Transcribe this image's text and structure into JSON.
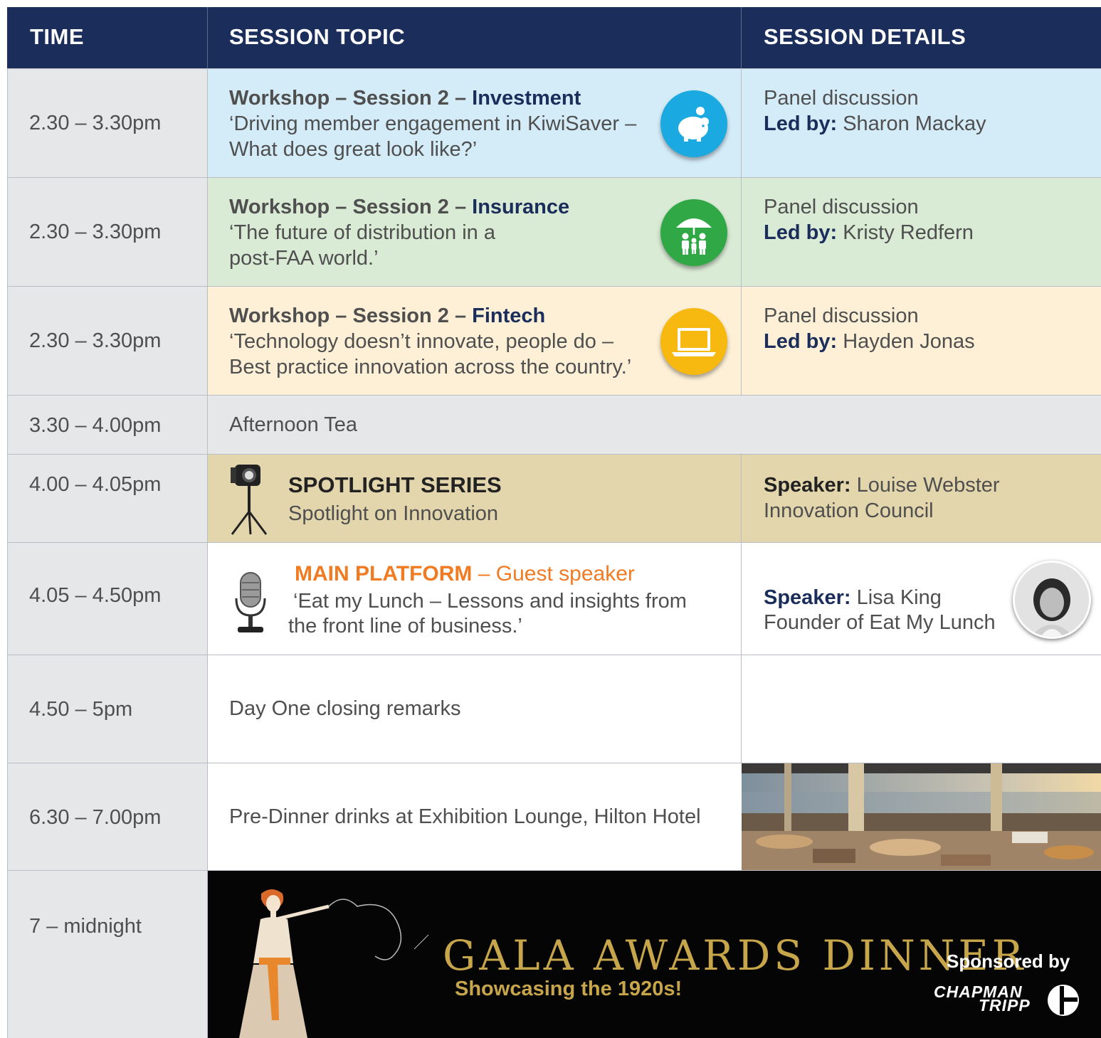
{
  "header": {
    "time": "TIME",
    "topic": "SESSION TOPIC",
    "details": "SESSION DETAILS"
  },
  "rows": [
    {
      "time": "2.30 – 3.30pm",
      "prefix": "Workshop – Session 2 – ",
      "stream": "Investment",
      "desc1": "‘Driving member engagement in KiwiSaver –",
      "desc2": "What does great look like?’",
      "icon": "piggy-bank-icon",
      "detail_line1": "Panel discussion",
      "led_label": "Led by:",
      "led_name": "Sharon Mackay",
      "bg": "#d4ecf8",
      "icon_color": "#1aa9e1"
    },
    {
      "time": "2.30 – 3.30pm",
      "prefix": "Workshop – Session 2 – ",
      "stream": "Insurance",
      "desc1": "‘The future of distribution in a",
      "desc2": "post-FAA world.’",
      "icon": "family-umbrella-icon",
      "detail_line1": "Panel discussion",
      "led_label": "Led by:",
      "led_name": "Kristy Redfern",
      "bg": "#d9ead5",
      "icon_color": "#31a846"
    },
    {
      "time": "2.30 – 3.30pm",
      "prefix": "Workshop – Session 2 – ",
      "stream": "Fintech",
      "desc1": "‘Technology doesn’t innovate, people do –",
      "desc2": "Best practice innovation across the country.’",
      "icon": "laptop-icon",
      "detail_line1": "Panel discussion",
      "led_label": "Led by:",
      "led_name": "Hayden Jonas",
      "bg": "#fdf0d6",
      "icon_color": "#f7b80f"
    }
  ],
  "tea": {
    "time": "3.30 – 4.00pm",
    "label": "Afternoon Tea"
  },
  "spotlight": {
    "time": "4.00 – 4.05pm",
    "title": "SPOTLIGHT SERIES",
    "subtitle": "Spotlight on Innovation",
    "speaker_label": "Speaker:",
    "speaker_name": "Louise Webster",
    "speaker_org": "Innovation Council",
    "icon": "spotlight-lamp-icon"
  },
  "main_platform": {
    "time": "4.05 – 4.50pm",
    "title": "MAIN PLATFORM",
    "suffix": " – Guest speaker",
    "desc1": "‘Eat my Lunch – Lessons and insights from",
    "desc2": "the front line of business.’",
    "speaker_label": "Speaker:",
    "speaker_name": "Lisa King",
    "speaker_role": "Founder of Eat My Lunch",
    "icon": "microphone-icon",
    "accent": "#f07b22"
  },
  "closing": {
    "time": "4.50 – 5pm",
    "label": "Day One closing remarks"
  },
  "drinks": {
    "time": "6.30 – 7.00pm",
    "label": "Pre-Dinner drinks at Exhibition Lounge, Hilton Hotel"
  },
  "gala": {
    "time": "7 – midnight",
    "title": "GALA AWARDS DINNER",
    "subtitle": "Showcasing the 1920s!",
    "sponsored": "Sponsored by",
    "sponsor_line1": "CHAPMAN",
    "sponsor_line2": "TRIPP"
  },
  "colors": {
    "navy": "#1b2d5a",
    "grey_cell": "#e6e7e9",
    "spotlight_bg": "#e3d5ac",
    "gold": "#c7a54b"
  }
}
